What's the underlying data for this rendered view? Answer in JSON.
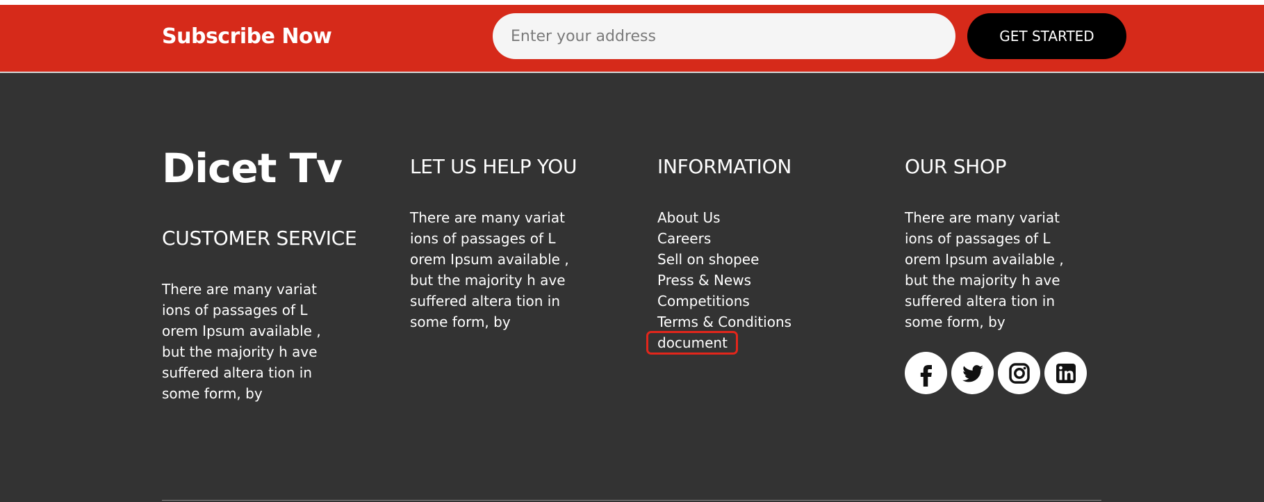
{
  "subscribe": {
    "title": "Subscribe Now",
    "input_placeholder": "Enter your address",
    "button_label": "GET STARTED",
    "bar_color": "#d62a1a"
  },
  "footer": {
    "background_color": "#333333",
    "logo": "Dicet Tv",
    "customer_service": {
      "heading": "CUSTOMER SERVICE",
      "text": "There are many variat ions of passages of L orem Ipsum available , but the majority h ave suffered altera tion in some form, by"
    },
    "help": {
      "heading": "LET US HELP YOU",
      "text": "There are many variat ions of passages of L orem Ipsum available , but the majority h ave suffered altera tion in some form, by"
    },
    "information": {
      "heading": "INFORMATION",
      "links": [
        {
          "label": "About Us"
        },
        {
          "label": "Careers"
        },
        {
          "label": "Sell on shopee"
        },
        {
          "label": "Press & News"
        },
        {
          "label": "Competitions"
        },
        {
          "label": "Terms & Conditions"
        },
        {
          "label": "document",
          "highlighted": true
        }
      ]
    },
    "shop": {
      "heading": "OUR SHOP",
      "text": "There are many variat ions of passages of L orem Ipsum available , but the majority h ave suffered altera tion in some form, by",
      "socials": [
        {
          "icon": "facebook-icon"
        },
        {
          "icon": "twitter-icon"
        },
        {
          "icon": "instagram-icon"
        },
        {
          "icon": "linkedin-icon"
        }
      ]
    }
  },
  "highlight_color": "#e3261b"
}
